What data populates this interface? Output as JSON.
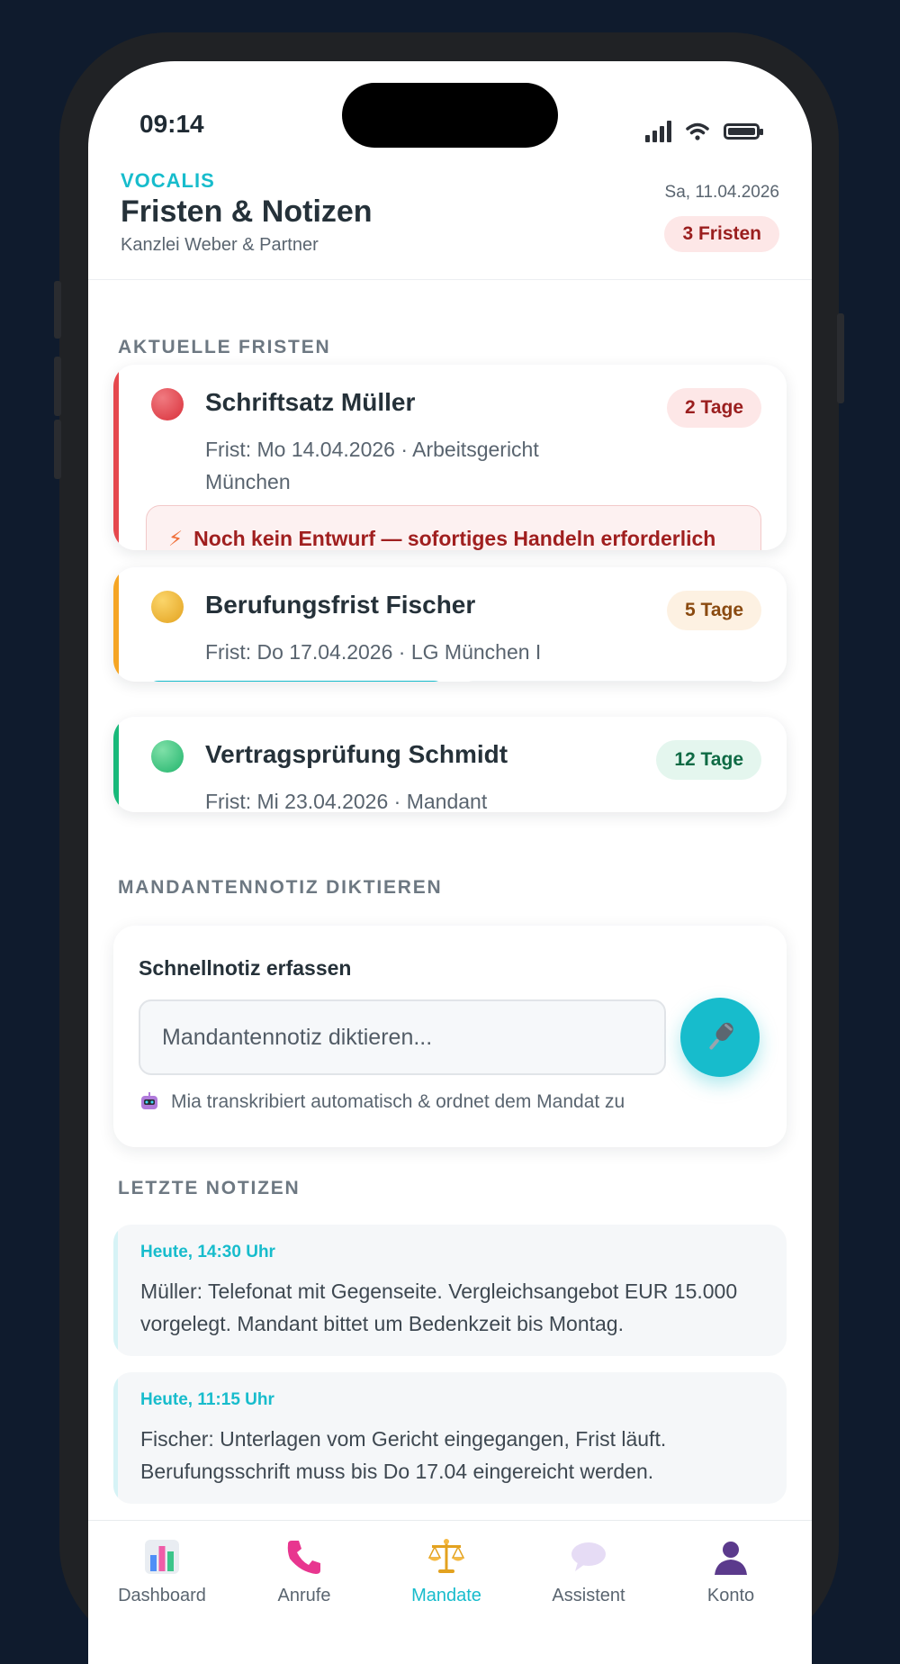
{
  "status": {
    "time": "09:14"
  },
  "header": {
    "brand": "VOCALIS",
    "title": "Fristen & Notizen",
    "subtitle": "Kanzlei Weber & Partner",
    "date": "Sa, 11.04.2026",
    "badge": "3 Fristen"
  },
  "sections": {
    "deadlines": "AKTUELLE FRISTEN",
    "dictate": "MANDANTENNOTIZ DIKTIEREN",
    "recent": "LETZTE NOTIZEN"
  },
  "deadlines": [
    {
      "title": "Schriftsatz Müller",
      "detail": "Frist: Mo 14.04.2026 · Arbeitsgericht München",
      "days": "2 Tage",
      "warning": "Noch kein Entwurf — sofortiges Handeln erforderlich",
      "color": "#e5484d"
    },
    {
      "title": "Berufungsfrist Fischer",
      "detail": "Frist: Do 17.04.2026 · LG München I",
      "days": "5 Tage",
      "color": "#f5a524"
    },
    {
      "title": "Vertragsprüfung Schmidt",
      "detail": "Frist: Mi 23.04.2026 · Mandant",
      "days": "12 Tage",
      "color": "#18b97a"
    }
  ],
  "quick_note": {
    "title": "Schnellnotiz erfassen",
    "placeholder": "Mandantennotiz diktieren...",
    "hint": "Mia transkribiert automatisch & ordnet dem Mandat zu"
  },
  "recent_notes": [
    {
      "time": "Heute, 14:30 Uhr",
      "text": "Müller: Telefonat mit Gegenseite. Vergleichsangebot EUR 15.000 vorgelegt. Mandant bittet um Bedenkzeit bis Montag."
    },
    {
      "time": "Heute, 11:15 Uhr",
      "text": "Fischer: Unterlagen vom Gericht eingegangen, Frist läuft. Berufungsschrift muss bis Do 17.04 eingereicht werden."
    }
  ],
  "tabs": [
    {
      "label": "Dashboard",
      "icon": "bar-chart-icon"
    },
    {
      "label": "Anrufe",
      "icon": "phone-icon"
    },
    {
      "label": "Mandate",
      "icon": "scales-icon",
      "active": true
    },
    {
      "label": "Assistent",
      "icon": "speech-bubble-icon"
    },
    {
      "label": "Konto",
      "icon": "person-icon"
    }
  ],
  "colors": {
    "accent": "#17bccc",
    "urgent": "#e5484d",
    "warning": "#f5a524",
    "ok": "#18b97a"
  }
}
